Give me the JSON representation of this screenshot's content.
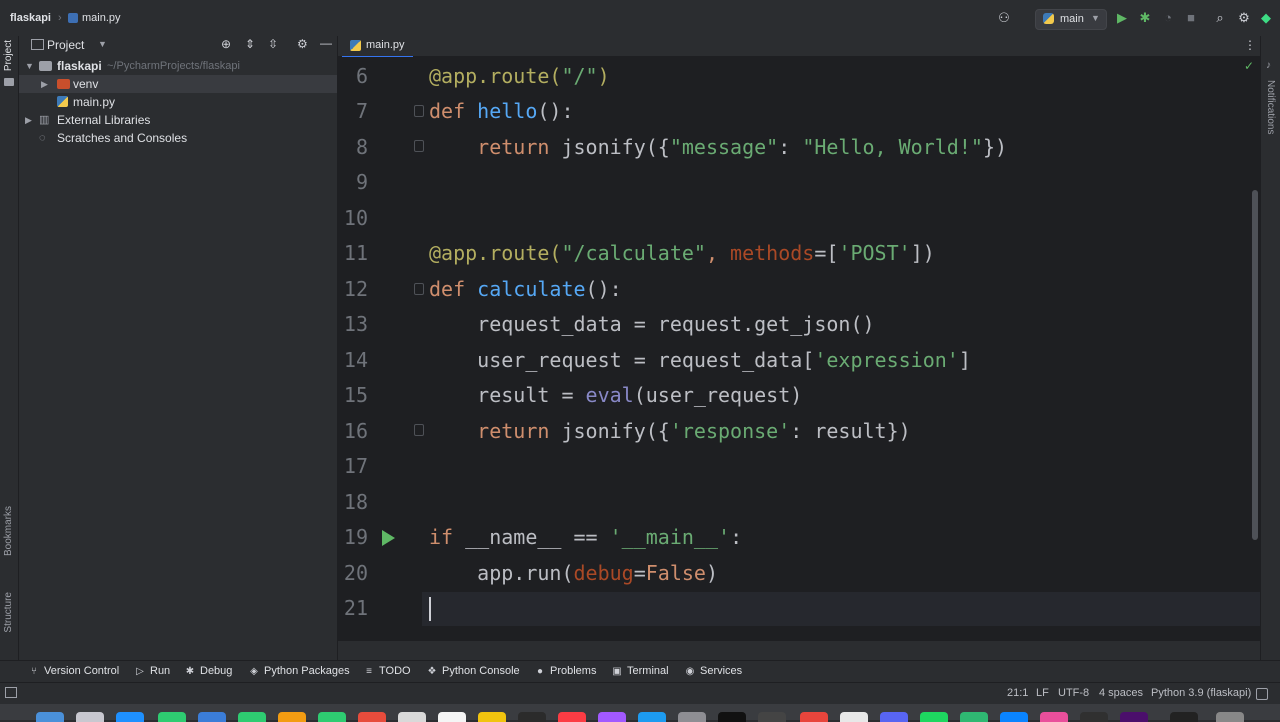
{
  "titlebar": {
    "project": "flaskapi",
    "file": "main.py",
    "branch": "main"
  },
  "project_panel": {
    "title": "Project",
    "tree": [
      {
        "label": "flaskapi",
        "path": "~/PycharmProjects/flaskapi"
      },
      {
        "label": "venv"
      },
      {
        "label": "main.py"
      },
      {
        "label": "External Libraries"
      },
      {
        "label": "Scratches and Consoles"
      }
    ]
  },
  "editor": {
    "tab": "main.py",
    "line_numbers": [
      "6",
      "7",
      "8",
      "9",
      "10",
      "11",
      "12",
      "13",
      "14",
      "15",
      "16",
      "17",
      "18",
      "19",
      "20",
      "21"
    ],
    "tokens": {
      "l6": [
        "@app.route(",
        "\"/\"",
        ")"
      ],
      "l7": [
        "def",
        "hello",
        "():"
      ],
      "l8": [
        "return",
        "jsonify({",
        "\"message\"",
        ": ",
        "\"Hello, World!\"",
        "})"
      ],
      "l11": [
        "@app.route(",
        "\"/calculate\"",
        ", ",
        "methods",
        "=[",
        "'POST'",
        "])"
      ],
      "l12": [
        "def",
        "calculate",
        "():"
      ],
      "l13": [
        "request_data = request.get_json()"
      ],
      "l14": [
        "user_request = request_data[",
        "'expression'",
        "]"
      ],
      "l15": [
        "result = ",
        "eval",
        "(user_request)"
      ],
      "l16": [
        "return",
        "jsonify({",
        "'response'",
        ": result})"
      ],
      "l19": [
        "if",
        "__name__ == ",
        "'__main__'",
        ":"
      ],
      "l20": [
        "app.run(",
        "debug",
        "=",
        "False",
        ")"
      ]
    }
  },
  "left_stripe": {
    "project": "Project",
    "bookmarks": "Bookmarks",
    "structure": "Structure"
  },
  "right_stripe": {
    "notifications": "Notifications"
  },
  "tool_windows": {
    "version_control": "Version Control",
    "run": "Run",
    "debug": "Debug",
    "python_packages": "Python Packages",
    "todo": "TODO",
    "python_console": "Python Console",
    "problems": "Problems",
    "terminal": "Terminal",
    "services": "Services"
  },
  "statusbar": {
    "position": "21:1",
    "line_sep": "LF",
    "encoding": "UTF-8",
    "indent": "4 spaces",
    "interpreter": "Python 3.9 (flaskapi)"
  },
  "colors": {
    "keyword": "#cf8e6d",
    "function": "#56a8f5",
    "string": "#6aab73",
    "decorator": "#b3ae60",
    "param": "#aa4926",
    "builtin": "#8888c6",
    "run_green": "#5fb865",
    "accent": "#3574f0"
  }
}
